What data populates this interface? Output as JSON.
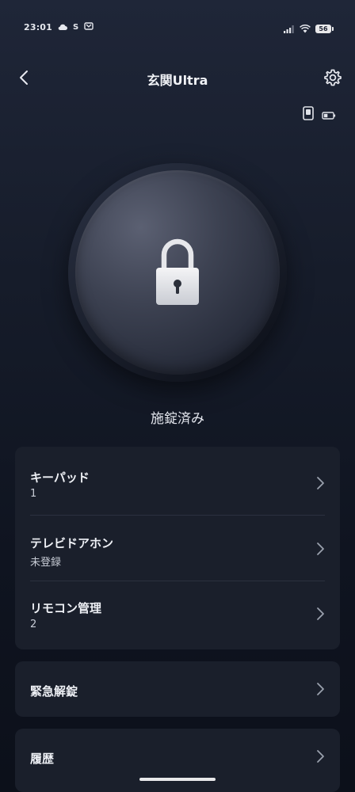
{
  "status_bar": {
    "time": "23:01",
    "app_glyph": "S",
    "battery_level": "56"
  },
  "header": {
    "title": "玄関Ultra",
    "back_icon": "chevron-left-icon",
    "settings_icon": "gear-icon"
  },
  "lock": {
    "state_label": "施錠済み",
    "icon": "padlock-icon"
  },
  "menu": {
    "items": [
      {
        "title": "キーパッド",
        "value": "1"
      },
      {
        "title": "テレビドアホン",
        "value": "未登録"
      },
      {
        "title": "リモコン管理",
        "value": "2"
      }
    ]
  },
  "emergency": {
    "title": "緊急解錠"
  },
  "history": {
    "title": "履歴"
  },
  "colors": {
    "background": "#131826",
    "card": "#1a1f2b",
    "text": "#eef0f5"
  }
}
